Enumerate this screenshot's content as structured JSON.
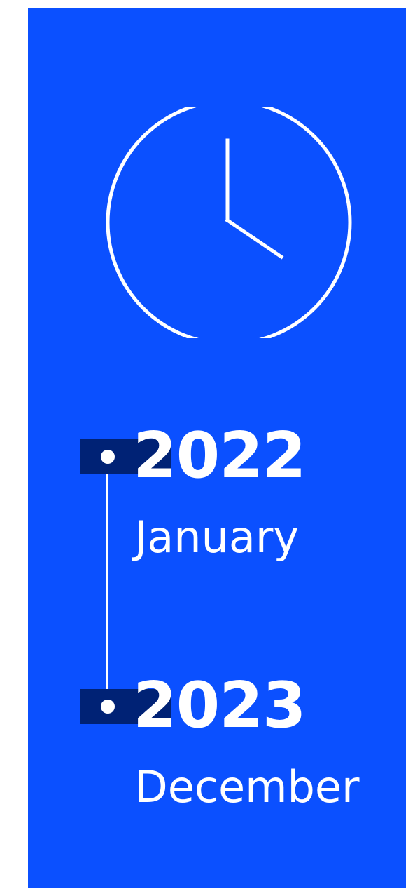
{
  "colors": {
    "panel_background": "#0b50ff",
    "marker_bar": "#002275",
    "foreground": "#ffffff"
  },
  "icon": {
    "name": "clock-icon",
    "time_shown": "4:00"
  },
  "timeline": {
    "start": {
      "year": "2022",
      "month": "January"
    },
    "end": {
      "year": "2023",
      "month": "December"
    }
  }
}
